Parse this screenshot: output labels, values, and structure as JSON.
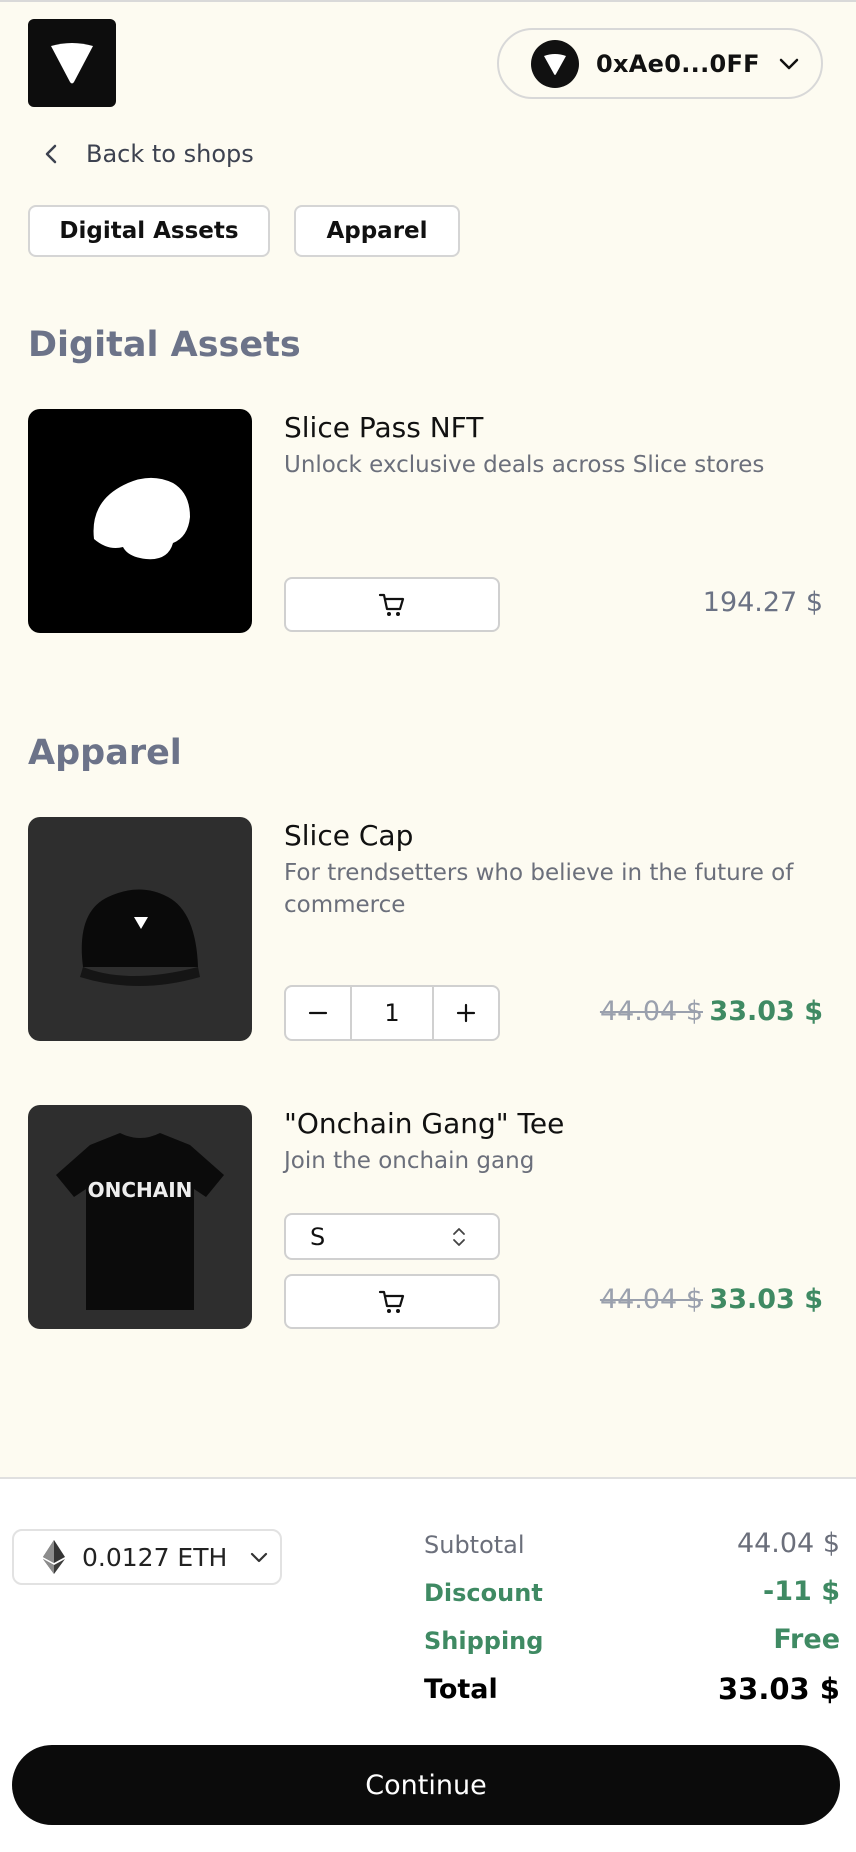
{
  "header": {
    "wallet_address": "0xAe0...0FF",
    "back_label": "Back to shops"
  },
  "categories": [
    "Digital Assets",
    "Apparel"
  ],
  "sections": {
    "digital_assets_title": "Digital Assets",
    "apparel_title": "Apparel"
  },
  "products": {
    "slice_pass": {
      "name": "Slice Pass NFT",
      "description": "Unlock exclusive deals across Slice stores",
      "price": "194.27 $"
    },
    "slice_cap": {
      "name": "Slice Cap",
      "description": "For trendsetters who believe in the future of commerce",
      "quantity": "1",
      "old_price": "44.04 $",
      "price": "33.03 $"
    },
    "tee": {
      "name": "\"Onchain Gang\" Tee",
      "description": "Join the onchain gang",
      "size": "S",
      "old_price": "44.04 $",
      "price": "33.03 $",
      "shirt_print": "ONCHAIN"
    }
  },
  "footer": {
    "currency_amount": "0.0127 ETH",
    "subtotal_label": "Subtotal",
    "subtotal_value": "44.04 $",
    "discount_label": "Discount",
    "discount_value": "-11 $",
    "shipping_label": "Shipping",
    "shipping_value": "Free",
    "total_label": "Total",
    "total_value": "33.03 $",
    "continue_label": "Continue"
  },
  "colors": {
    "background": "#fdfbf1",
    "section_title": "#6c7389",
    "discount_green": "#3f8a63",
    "button_dark": "#0b0b0b"
  }
}
